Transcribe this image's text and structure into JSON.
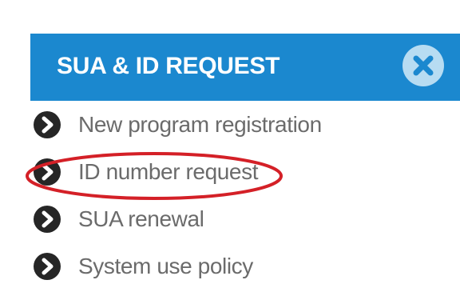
{
  "panel": {
    "title": "SUA & ID REQUEST",
    "close_icon": "close-icon",
    "header_color": "#1b88cf",
    "close_color": "#b7dcf2"
  },
  "menu": {
    "items": [
      {
        "label": "New program registration",
        "icon": "chevron-right-icon"
      },
      {
        "label": "ID number request",
        "icon": "chevron-right-icon",
        "highlighted": true
      },
      {
        "label": "SUA renewal",
        "icon": "chevron-right-icon"
      },
      {
        "label": "System use policy",
        "icon": "chevron-right-icon"
      }
    ]
  },
  "annotation": {
    "type": "highlight-oval",
    "color": "#d42027"
  }
}
